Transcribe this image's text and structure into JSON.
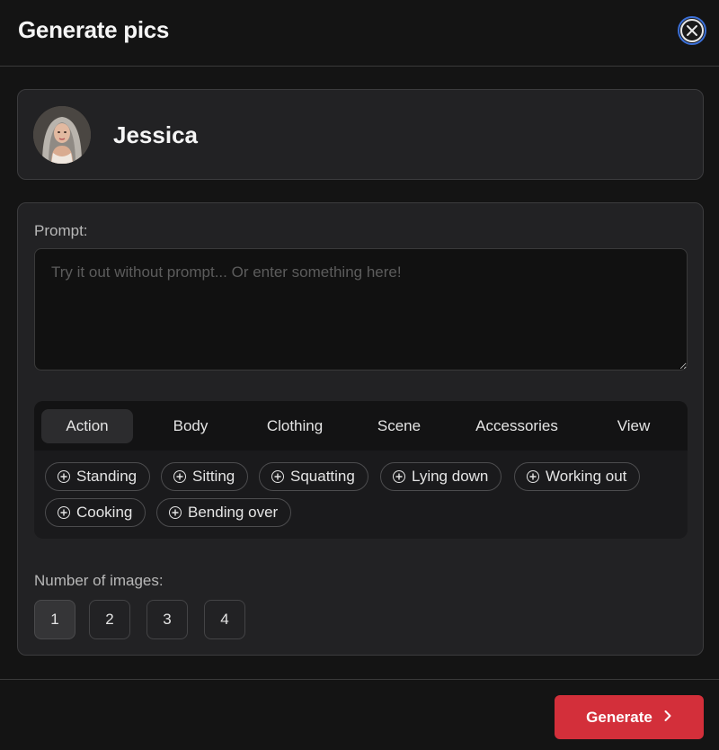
{
  "header": {
    "title": "Generate pics",
    "close_icon": "close-icon"
  },
  "character": {
    "name": "Jessica",
    "avatar_icon": "avatar"
  },
  "prompt": {
    "label": "Prompt:",
    "value": "",
    "placeholder": "Try it out without prompt... Or enter something here!"
  },
  "tabs": [
    {
      "label": "Action",
      "active": true
    },
    {
      "label": "Body",
      "active": false
    },
    {
      "label": "Clothing",
      "active": false
    },
    {
      "label": "Scene",
      "active": false
    },
    {
      "label": "Accessories",
      "active": false
    },
    {
      "label": "View",
      "active": false
    }
  ],
  "chips": [
    {
      "label": "Standing"
    },
    {
      "label": "Sitting"
    },
    {
      "label": "Squatting"
    },
    {
      "label": "Lying down"
    },
    {
      "label": "Working out"
    },
    {
      "label": "Cooking"
    },
    {
      "label": "Bending over"
    }
  ],
  "count": {
    "label": "Number of images:",
    "options": [
      "1",
      "2",
      "3",
      "4"
    ],
    "selected": "1"
  },
  "footer": {
    "generate_label": "Generate",
    "generate_icon": "chevron-right-icon"
  },
  "colors": {
    "accent": "#d32f3a",
    "focus_ring": "#3b6fd6",
    "background": "#141414",
    "card": "#222224"
  }
}
